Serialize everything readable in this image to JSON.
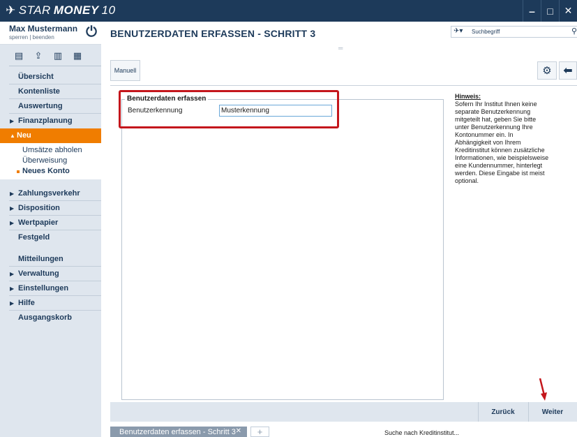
{
  "app": {
    "brand_prefix": "STAR",
    "brand_bold": "MONEY",
    "brand_version": "10",
    "window_buttons": [
      "‒",
      "□",
      "✕"
    ]
  },
  "user": {
    "name": "Max Mustermann",
    "links": "sperren | beenden"
  },
  "header": {
    "title": "BENUTZERDATEN ERFASSEN - SCHRITT 3",
    "search_placeholder": "Suchbegriff"
  },
  "sidebar": {
    "items": [
      {
        "label": "Übersicht",
        "arrow": ""
      },
      {
        "label": "Kontenliste",
        "arrow": ""
      },
      {
        "label": "Auswertung",
        "arrow": ""
      },
      {
        "label": "Finanzplanung",
        "arrow": "▶"
      },
      {
        "label": "Neu",
        "arrow": "▲"
      }
    ],
    "subitems": [
      "Umsätze abholen",
      "Überweisung",
      "Neues Konto"
    ],
    "items2": [
      {
        "label": "Zahlungsverkehr",
        "arrow": "▶"
      },
      {
        "label": "Disposition",
        "arrow": "▶"
      },
      {
        "label": "Wertpapier",
        "arrow": "▶"
      },
      {
        "label": "Festgeld",
        "arrow": ""
      }
    ],
    "items3": [
      {
        "label": "Mitteilungen",
        "arrow": ""
      },
      {
        "label": "Verwaltung",
        "arrow": "▶"
      },
      {
        "label": "Einstellungen",
        "arrow": "▶"
      },
      {
        "label": "Hilfe",
        "arrow": "▶"
      },
      {
        "label": "Ausgangskorb",
        "arrow": ""
      }
    ]
  },
  "toolbar": {
    "manuell_label": "Manuell"
  },
  "form": {
    "legend": "Benutzerdaten erfassen",
    "field_label": "Benutzerkennung",
    "field_value": "Musterkennung"
  },
  "hint": {
    "title": "Hinweis:",
    "text": "Sofern Ihr Institut Ihnen keine separate Benutzerkennung mitgeteilt hat, geben Sie bitte unter Benutzerkennung Ihre Kontonummer ein. In Abhängigkeit von Ihrem Kreditinstitut können zusätzliche Informationen, wie beispielsweise eine Kundennummer, hinterlegt werden. Diese Eingabe ist meist optional."
  },
  "footer": {
    "back_label": "Zurück",
    "next_label": "Weiter"
  },
  "tabs": {
    "active_label": "Benutzerdaten erfassen - Schritt 3",
    "add_label": "+",
    "status": "Suche nach Kreditinstitut..."
  },
  "colors": {
    "brand_navy": "#1d3a5a",
    "accent_orange": "#f07d00",
    "highlight_red": "#c4161c"
  }
}
